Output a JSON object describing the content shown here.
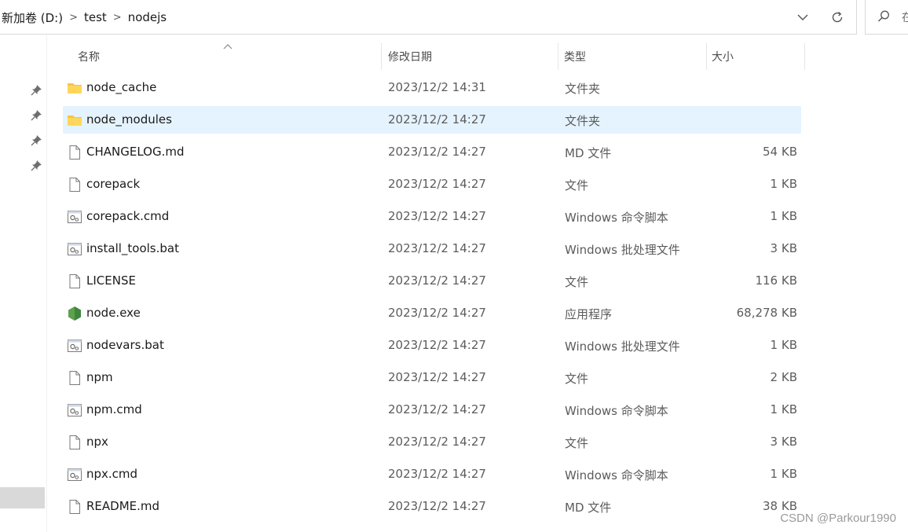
{
  "address_bar": {
    "crumbs": [
      "新加卷 (D:)",
      "test",
      "nodejs"
    ],
    "separator": ">"
  },
  "search": {
    "placeholder": "在"
  },
  "columns": {
    "name": "名称",
    "date": "修改日期",
    "type": "类型",
    "size": "大小",
    "sorted_by": "name"
  },
  "colors": {
    "selected_row": "#e5f3ff",
    "folder": "#f5c445",
    "node_icon": "#5fa04e"
  },
  "files": [
    {
      "name": "node_cache",
      "date": "2023/12/2 14:31",
      "type": "文件夹",
      "size": "",
      "icon": "folder-icon",
      "selected": false
    },
    {
      "name": "node_modules",
      "date": "2023/12/2 14:27",
      "type": "文件夹",
      "size": "",
      "icon": "folder-icon",
      "selected": true
    },
    {
      "name": "CHANGELOG.md",
      "date": "2023/12/2 14:27",
      "type": "MD 文件",
      "size": "54 KB",
      "icon": "file-icon",
      "selected": false
    },
    {
      "name": "corepack",
      "date": "2023/12/2 14:27",
      "type": "文件",
      "size": "1 KB",
      "icon": "file-icon",
      "selected": false
    },
    {
      "name": "corepack.cmd",
      "date": "2023/12/2 14:27",
      "type": "Windows 命令脚本",
      "size": "1 KB",
      "icon": "script-icon",
      "selected": false
    },
    {
      "name": "install_tools.bat",
      "date": "2023/12/2 14:27",
      "type": "Windows 批处理文件",
      "size": "3 KB",
      "icon": "script-icon",
      "selected": false
    },
    {
      "name": "LICENSE",
      "date": "2023/12/2 14:27",
      "type": "文件",
      "size": "116 KB",
      "icon": "file-icon",
      "selected": false
    },
    {
      "name": "node.exe",
      "date": "2023/12/2 14:27",
      "type": "应用程序",
      "size": "68,278 KB",
      "icon": "nodejs-icon",
      "selected": false
    },
    {
      "name": "nodevars.bat",
      "date": "2023/12/2 14:27",
      "type": "Windows 批处理文件",
      "size": "1 KB",
      "icon": "script-icon",
      "selected": false
    },
    {
      "name": "npm",
      "date": "2023/12/2 14:27",
      "type": "文件",
      "size": "2 KB",
      "icon": "file-icon",
      "selected": false
    },
    {
      "name": "npm.cmd",
      "date": "2023/12/2 14:27",
      "type": "Windows 命令脚本",
      "size": "1 KB",
      "icon": "script-icon",
      "selected": false
    },
    {
      "name": "npx",
      "date": "2023/12/2 14:27",
      "type": "文件",
      "size": "3 KB",
      "icon": "file-icon",
      "selected": false
    },
    {
      "name": "npx.cmd",
      "date": "2023/12/2 14:27",
      "type": "Windows 命令脚本",
      "size": "1 KB",
      "icon": "script-icon",
      "selected": false
    },
    {
      "name": "README.md",
      "date": "2023/12/2 14:27",
      "type": "MD 文件",
      "size": "38 KB",
      "icon": "file-icon",
      "selected": false
    }
  ],
  "watermark": "CSDN @Parkour1990"
}
